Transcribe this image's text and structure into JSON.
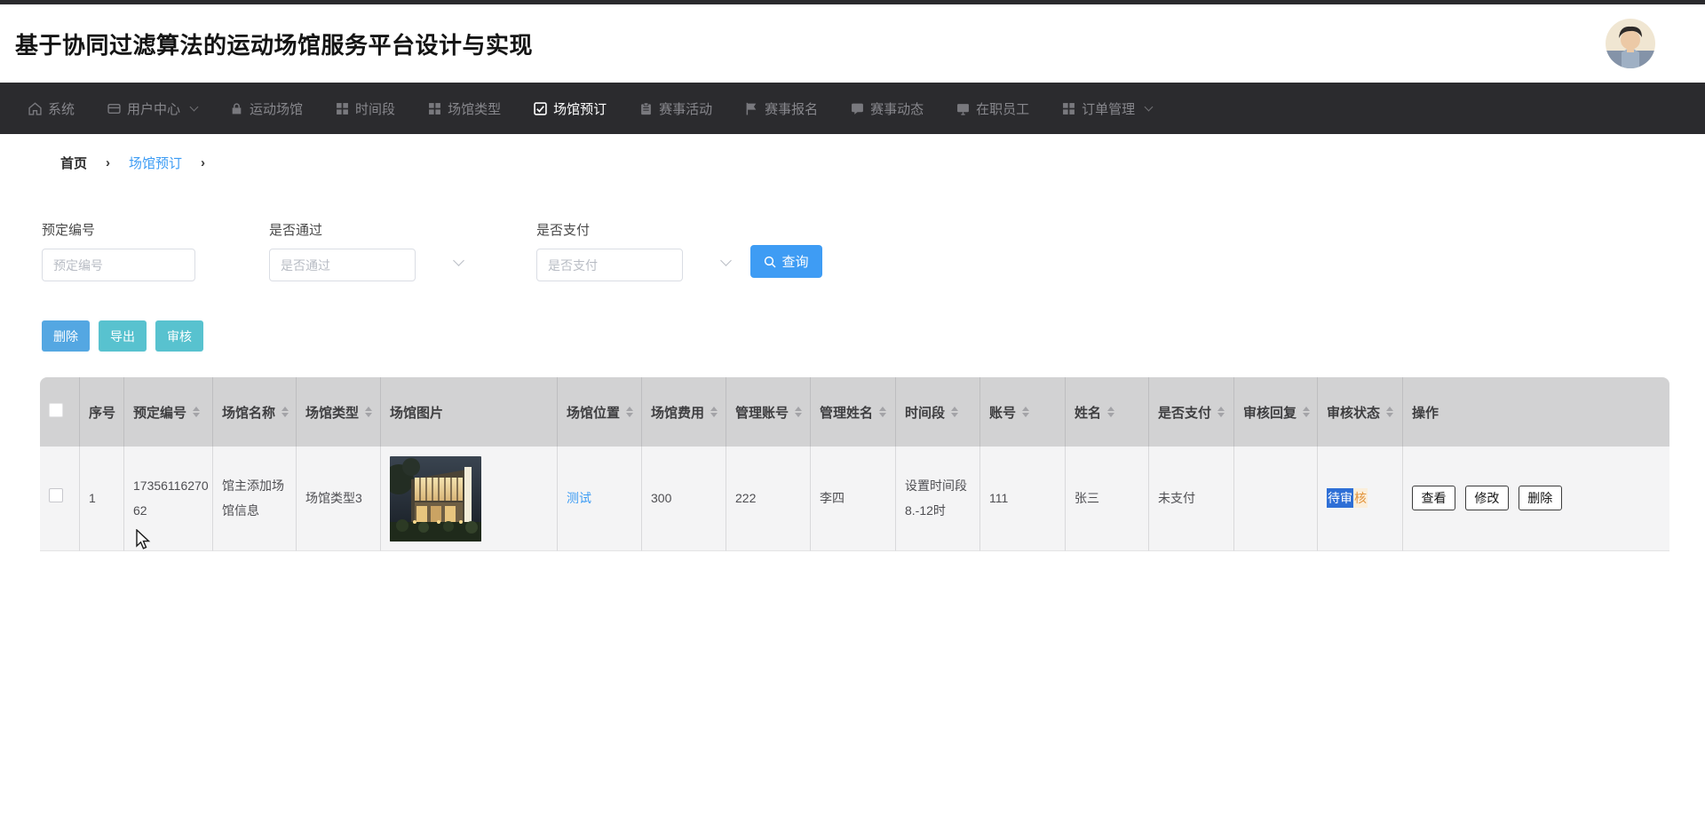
{
  "header": {
    "title": "基于协同过滤算法的运动场馆服务平台设计与实现"
  },
  "nav": {
    "items": [
      {
        "label": "系统",
        "icon": "home-icon",
        "active": false,
        "dropdown": false
      },
      {
        "label": "用户中心",
        "icon": "user-card-icon",
        "active": false,
        "dropdown": true
      },
      {
        "label": "运动场馆",
        "icon": "lock-icon",
        "active": false,
        "dropdown": false
      },
      {
        "label": "时间段",
        "icon": "grid-icon",
        "active": false,
        "dropdown": false
      },
      {
        "label": "场馆类型",
        "icon": "grid-icon",
        "active": false,
        "dropdown": false
      },
      {
        "label": "场馆预订",
        "icon": "checkbox-icon",
        "active": true,
        "dropdown": false
      },
      {
        "label": "赛事活动",
        "icon": "clipboard-icon",
        "active": false,
        "dropdown": false
      },
      {
        "label": "赛事报名",
        "icon": "flag-icon",
        "active": false,
        "dropdown": false
      },
      {
        "label": "赛事动态",
        "icon": "chat-icon",
        "active": false,
        "dropdown": false
      },
      {
        "label": "在职员工",
        "icon": "monitor-icon",
        "active": false,
        "dropdown": false
      },
      {
        "label": "订单管理",
        "icon": "grid-icon",
        "active": false,
        "dropdown": true
      }
    ]
  },
  "breadcrumb": {
    "home": "首页",
    "current": "场馆预订",
    "separator": "›"
  },
  "filters": {
    "booking_no": {
      "label": "预定编号",
      "placeholder": "预定编号",
      "value": ""
    },
    "approved": {
      "label": "是否通过",
      "placeholder": "是否通过",
      "value": ""
    },
    "paid": {
      "label": "是否支付",
      "placeholder": "是否支付",
      "value": ""
    },
    "search_label": "查询"
  },
  "bulk_actions": {
    "delete": "删除",
    "export": "导出",
    "audit": "审核"
  },
  "table": {
    "columns": [
      {
        "label": "序号",
        "sortable": false
      },
      {
        "label": "预定编号",
        "sortable": true
      },
      {
        "label": "场馆名称",
        "sortable": true
      },
      {
        "label": "场馆类型",
        "sortable": true
      },
      {
        "label": "场馆图片",
        "sortable": false
      },
      {
        "label": "场馆位置",
        "sortable": true
      },
      {
        "label": "场馆费用",
        "sortable": true
      },
      {
        "label": "管理账号",
        "sortable": true
      },
      {
        "label": "管理姓名",
        "sortable": true
      },
      {
        "label": "时间段",
        "sortable": true
      },
      {
        "label": "账号",
        "sortable": true
      },
      {
        "label": "姓名",
        "sortable": true
      },
      {
        "label": "是否支付",
        "sortable": true
      },
      {
        "label": "审核回复",
        "sortable": true
      },
      {
        "label": "审核状态",
        "sortable": true
      },
      {
        "label": "操作",
        "sortable": false
      }
    ],
    "row": {
      "index": "1",
      "booking_no": "1735611627062",
      "venue_name": "馆主添加场馆信息",
      "venue_type": "场馆类型3",
      "venue_image": "venue-photo-night-building",
      "venue_location": "测试",
      "venue_fee": "300",
      "admin_account": "222",
      "admin_name": "李四",
      "time_slot": "设置时间段8.-12时",
      "account": "111",
      "name": "张三",
      "pay_status": "未支付",
      "audit_reply": "",
      "audit_status_selected": "待审",
      "audit_status_rest": "核",
      "ops": {
        "view": "查看",
        "edit": "修改",
        "delete": "删除"
      }
    }
  },
  "colors": {
    "accent_blue": "#3e9cf4",
    "bulk_delete_blue": "#54a7e2",
    "bulk_teal": "#58c2cf",
    "selection_blue": "#2e6fd6",
    "status_orange": "#e2953f",
    "nav_bg": "#2b2b2e",
    "table_header_bg": "#d2d2d3"
  }
}
